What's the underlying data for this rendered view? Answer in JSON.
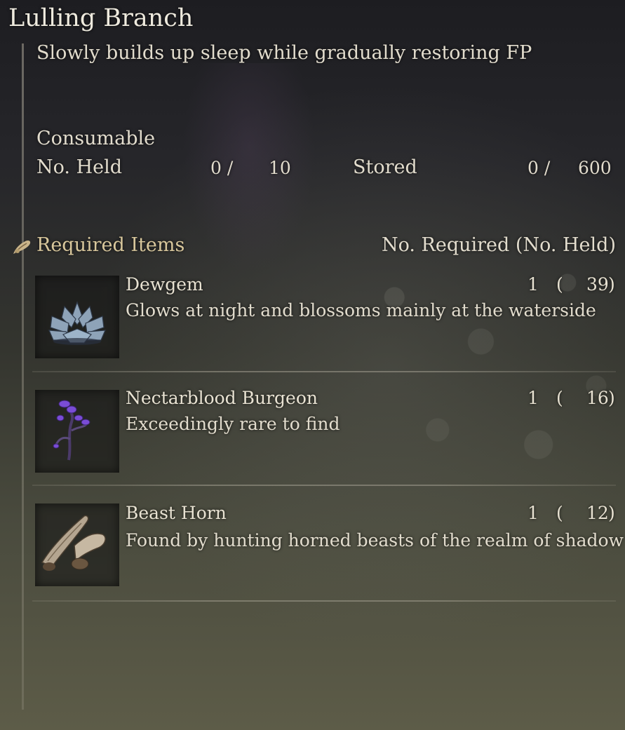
{
  "item": {
    "title": "Lulling Branch",
    "description": "Slowly builds up sleep while gradually restoring FP",
    "category": "Consumable"
  },
  "stats": {
    "held_label": "No. Held",
    "held_value": "0 /",
    "held_max": "10",
    "stored_label": "Stored",
    "stored_value": "0 /",
    "stored_max": "600"
  },
  "required": {
    "header_label": "Required Items",
    "header_icon": "crafting-material-icon",
    "count_header": "No. Required (No. Held)",
    "items": [
      {
        "name": "Dewgem",
        "description": "Glows at night and blossoms mainly at the waterside",
        "required": "1",
        "open": "(",
        "held": "39",
        "close": ")",
        "icon": "dewgem-flower-icon"
      },
      {
        "name": "Nectarblood Burgeon",
        "description": "Exceedingly rare to find",
        "required": "1",
        "open": "(",
        "held": "16",
        "close": ")",
        "icon": "nectarblood-burgeon-icon"
      },
      {
        "name": "Beast Horn",
        "description": "Found by hunting horned beasts of the realm of shadow",
        "required": "1",
        "open": "(",
        "held": "12",
        "close": ")",
        "icon": "beast-horn-icon"
      }
    ]
  },
  "colors": {
    "header_gold": "#d8c79c",
    "text": "#e2dccd"
  }
}
